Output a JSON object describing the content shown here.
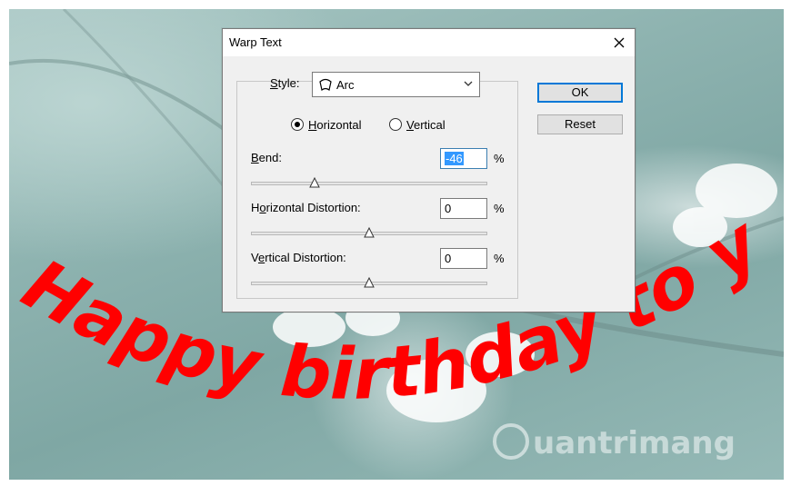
{
  "dialog": {
    "title": "Warp Text",
    "style": {
      "label_prefix": "",
      "label_accel": "S",
      "label_rest": "tyle:",
      "value": "Arc",
      "icon": "arc-warp-icon"
    },
    "orientation": {
      "horizontal": {
        "accel": "H",
        "rest": "orizontal",
        "selected": true
      },
      "vertical": {
        "accel": "V",
        "rest": "ertical",
        "selected": false
      }
    },
    "bend": {
      "accel": "B",
      "rest": "end:",
      "value": "-46",
      "unit": "%",
      "slider_fraction": 0.27
    },
    "horizontal_distortion": {
      "pre": "H",
      "accel": "o",
      "rest": "rizontal Distortion:",
      "value": "0",
      "unit": "%",
      "slider_fraction": 0.5
    },
    "vertical_distortion": {
      "pre": "V",
      "accel": "e",
      "rest": "rtical Distortion:",
      "value": "0",
      "unit": "%",
      "slider_fraction": 0.5
    },
    "buttons": {
      "ok": "OK",
      "reset": "Reset"
    }
  },
  "canvas": {
    "warped_text": "Happy birthday to you",
    "text_color": "#ff0000",
    "watermark": "uantrimang"
  }
}
